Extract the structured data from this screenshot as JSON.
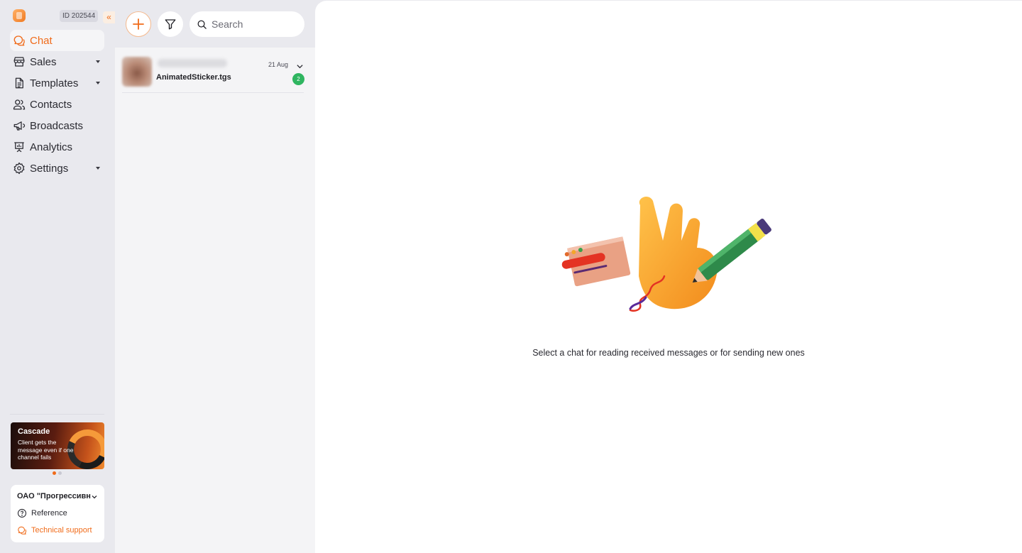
{
  "sidebar": {
    "account_id": "ID 202544",
    "collapse_icon": "«",
    "nav": [
      {
        "label": "Chat",
        "icon": "chat-icon",
        "active": true
      },
      {
        "label": "Sales",
        "icon": "store-icon",
        "dropdown": true
      },
      {
        "label": "Templates",
        "icon": "document-icon",
        "dropdown": true
      },
      {
        "label": "Contacts",
        "icon": "users-icon"
      },
      {
        "label": "Broadcasts",
        "icon": "megaphone-icon"
      },
      {
        "label": "Analytics",
        "icon": "presentation-chart-icon"
      },
      {
        "label": "Settings",
        "icon": "gear-icon",
        "dropdown": true
      }
    ],
    "promo": {
      "title": "Cascade",
      "text": "Client gets the message even if one channel fails"
    },
    "org": {
      "name": "ОАО \"Прогрессивн",
      "reference": "Reference",
      "support": "Technical support"
    }
  },
  "chat_list": {
    "search_placeholder": "Search",
    "items": [
      {
        "date": "21 Aug",
        "preview": "AnimatedSticker.tgs",
        "unread": "2"
      }
    ]
  },
  "main": {
    "empty_state_text": "Select a chat for reading received messages or for sending new ones"
  },
  "colors": {
    "accent": "#f06b1a",
    "badge": "#2fb560",
    "sidebar_bg": "#e9e9ee"
  }
}
